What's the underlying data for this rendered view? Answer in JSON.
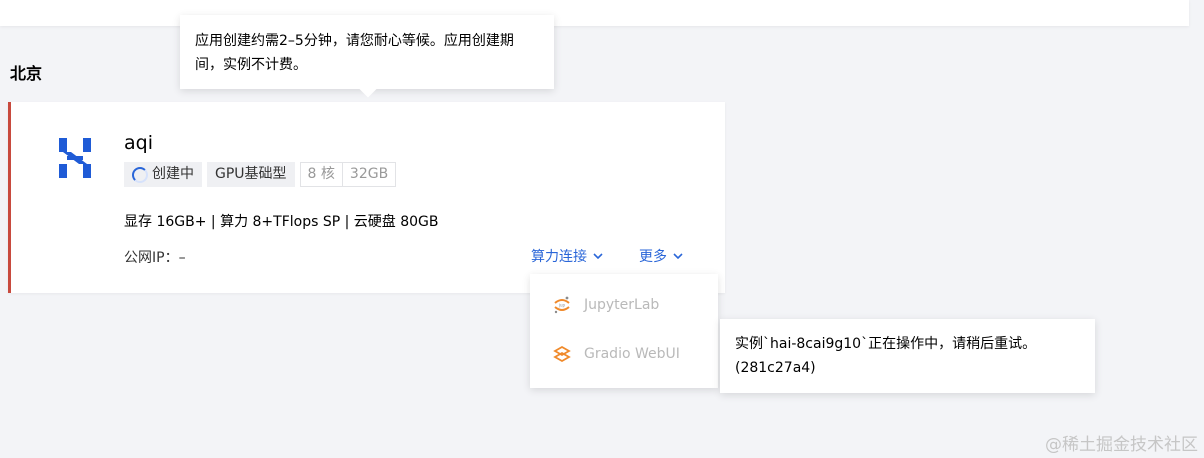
{
  "region": {
    "title": "北京"
  },
  "instance": {
    "name": "aqi",
    "status": "创建中",
    "gpu_type": "GPU基础型",
    "cpu": "8 核",
    "memory": "32GB",
    "specs": "显存 16GB+ | 算力 8+TFlops SP | 云硬盘 80GB",
    "public_ip": "公网IP：–",
    "connect_label": "算力连接",
    "more_label": "更多"
  },
  "tooltip_create": "应用创建约需2–5分钟，请您耐心等候。应用创建期间，实例不计费。",
  "dropdown": {
    "items": [
      {
        "label": "JupyterLab",
        "icon": "jupyter-icon"
      },
      {
        "label": "Gradio WebUI",
        "icon": "gradio-icon"
      }
    ]
  },
  "tooltip_error": {
    "line1": "实例`hai-8cai9g10`正在操作中，请稍后重试。",
    "line2": "(281c27a4)"
  },
  "watermark": "@稀土掘金技术社区",
  "colors": {
    "accent": "#2a66d8",
    "card_border": "#c84a3e",
    "logo": "#1f5bd6"
  }
}
